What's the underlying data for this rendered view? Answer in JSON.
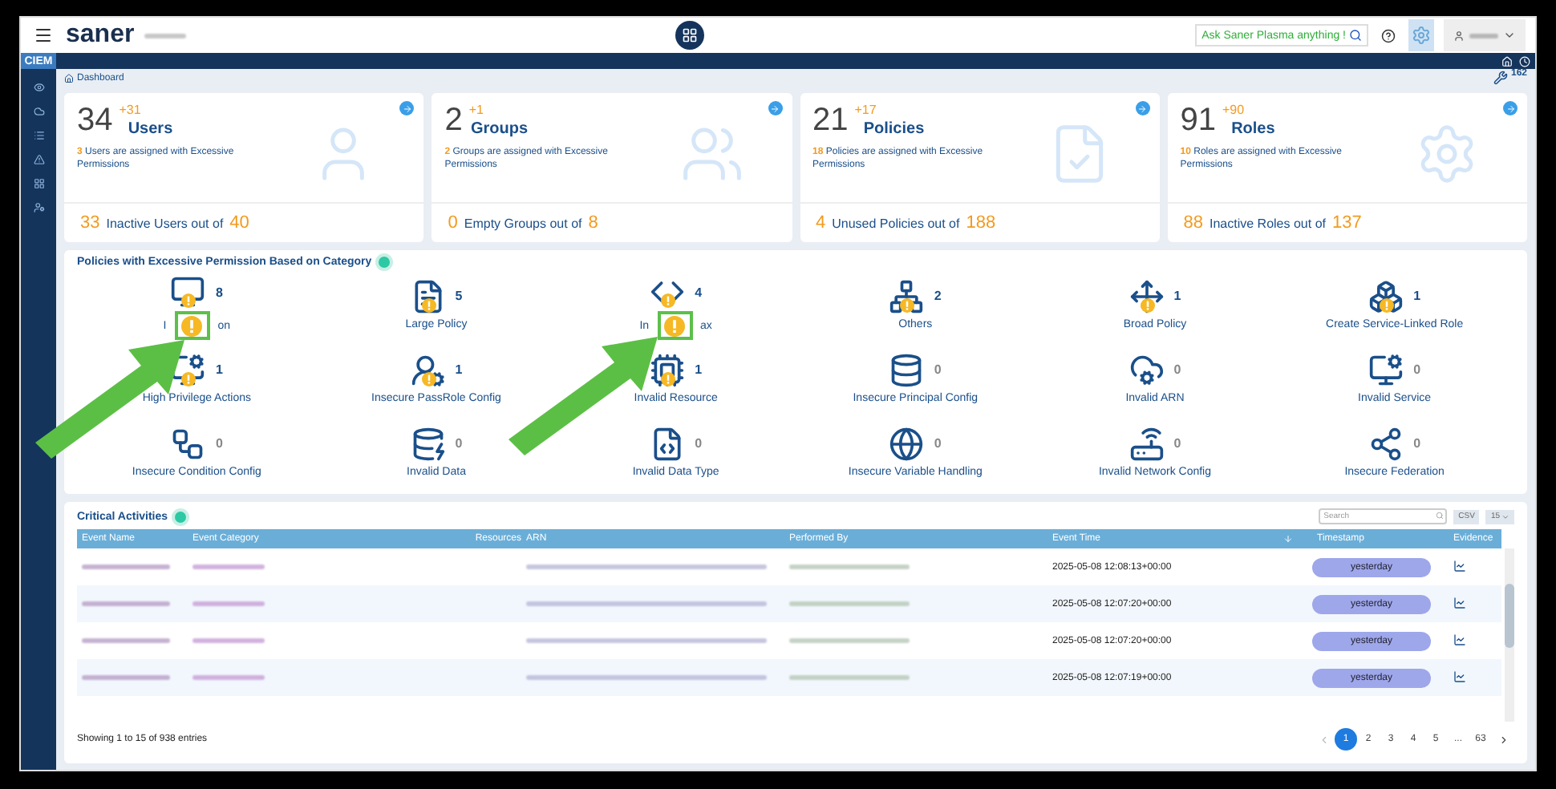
{
  "topbar": {
    "logo": "saner",
    "ask": "Ask Saner Plasma anything !"
  },
  "nav": {
    "module": "CIEM"
  },
  "breadcrumb": {
    "label": "Dashboard",
    "tasks": "162"
  },
  "cards": [
    {
      "count": "34",
      "delta": "+31",
      "title": "Users",
      "flagged": "3",
      "flag_text": "Users are assigned with Excessive Permissions",
      "foot_count": "33",
      "foot_text": "Inactive Users out of",
      "foot_total": "40"
    },
    {
      "count": "2",
      "delta": "+1",
      "title": "Groups",
      "flagged": "2",
      "flag_text": "Groups are assigned with Excessive Permissions",
      "foot_count": "0",
      "foot_text": "Empty Groups out of",
      "foot_total": "8"
    },
    {
      "count": "21",
      "delta": "+17",
      "title": "Policies",
      "flagged": "18",
      "flag_text": "Policies are assigned with Excessive Permissions",
      "foot_count": "4",
      "foot_text": "Unused Policies out of",
      "foot_total": "188"
    },
    {
      "count": "91",
      "delta": "+90",
      "title": "Roles",
      "flagged": "10",
      "flag_text": "Roles are assigned with Excessive Permissions",
      "foot_count": "88",
      "foot_text": "Inactive Roles out of",
      "foot_total": "137"
    }
  ],
  "categories": {
    "title": "Policies with Excessive Permission Based on Category",
    "items": [
      {
        "label_start": "I",
        "label_end": "on",
        "count": "8",
        "warning": true,
        "highlighted": true
      },
      {
        "label": "Large Policy",
        "count": "5",
        "warning": true,
        "highlighted": false
      },
      {
        "label_start": "In",
        "label_end": "ax",
        "count": "4",
        "warning": true,
        "highlighted": true
      },
      {
        "label": "Others",
        "count": "2",
        "warning": true,
        "highlighted": false
      },
      {
        "label": "Broad Policy",
        "count": "1",
        "warning": true,
        "highlighted": false
      },
      {
        "label": "Create Service-Linked Role",
        "count": "1",
        "warning": true,
        "highlighted": false
      },
      {
        "label": "High Privilege Actions",
        "count": "1",
        "warning": true,
        "highlighted": false
      },
      {
        "label": "Insecure PassRole Config",
        "count": "1",
        "warning": true,
        "highlighted": false
      },
      {
        "label": "Invalid Resource",
        "count": "1",
        "warning": true,
        "highlighted": false
      },
      {
        "label": "Insecure Principal Config",
        "count": "0",
        "warning": false,
        "highlighted": false
      },
      {
        "label": "Invalid ARN",
        "count": "0",
        "warning": false,
        "highlighted": false
      },
      {
        "label": "Invalid Service",
        "count": "0",
        "warning": false,
        "highlighted": false
      },
      {
        "label": "Insecure Condition Config",
        "count": "0",
        "warning": false,
        "highlighted": false
      },
      {
        "label": "Invalid Data",
        "count": "0",
        "warning": false,
        "highlighted": false
      },
      {
        "label": "Invalid Data Type",
        "count": "0",
        "warning": false,
        "highlighted": false
      },
      {
        "label": "Insecure Variable Handling",
        "count": "0",
        "warning": false,
        "highlighted": false
      },
      {
        "label": "Invalid Network Config",
        "count": "0",
        "warning": false,
        "highlighted": false
      },
      {
        "label": "Insecure Federation",
        "count": "0",
        "warning": false,
        "highlighted": false
      }
    ]
  },
  "activities": {
    "title": "Critical Activities",
    "search": {
      "placeholder": "Search"
    },
    "export": "CSV",
    "page_size": "15",
    "columns": [
      "Event Name",
      "Event Category",
      "Resources",
      "ARN",
      "Performed By",
      "Event Time",
      "Timestamp",
      "Evidence"
    ],
    "rows": [
      {
        "event_time": "2025-05-08 12:08:13+00:00",
        "timestamp": "yesterday"
      },
      {
        "event_time": "2025-05-08 12:07:20+00:00",
        "timestamp": "yesterday"
      },
      {
        "event_time": "2025-05-08 12:07:20+00:00",
        "timestamp": "yesterday"
      },
      {
        "event_time": "2025-05-08 12:07:19+00:00",
        "timestamp": "yesterday"
      }
    ],
    "summary": "Showing 1 to 15 of 938 entries",
    "pages": [
      {
        "label": "1",
        "selected": true
      },
      {
        "label": "2",
        "selected": false
      },
      {
        "label": "3",
        "selected": false
      },
      {
        "label": "4",
        "selected": false
      },
      {
        "label": "5",
        "selected": false
      },
      {
        "label": "...",
        "selected": false
      },
      {
        "label": "63",
        "selected": false
      }
    ]
  }
}
